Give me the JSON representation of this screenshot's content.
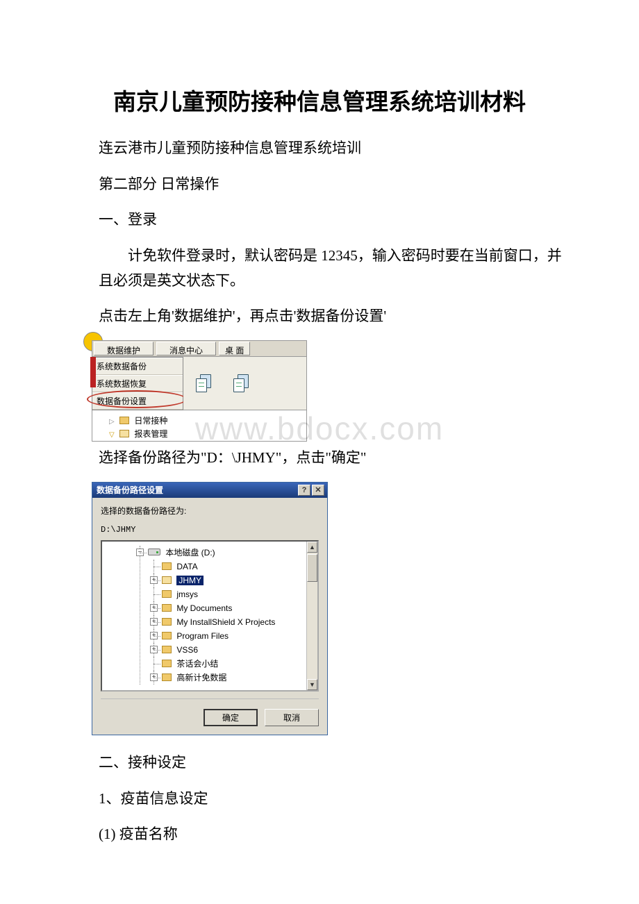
{
  "title": "南京儿童预防接种信息管理系统培训材料",
  "intro": {
    "line1": "连云港市儿童预防接种信息管理系统培训",
    "line2": "第二部分 日常操作",
    "sec1_title": "一、登录",
    "sec1_p1": "计免软件登录时，默认密码是 12345，输入密码时要在当前窗口，并且必须是英文状态下。",
    "sec1_p2": "点击左上角'数据维护'，再点击'数据备份设置'",
    "sec1_p3": "选择备份路径为\"D：\\JHMY\"，点击\"确定\"",
    "sec2_title": "二、接种设定",
    "sec2_item1": "1、疫苗信息设定",
    "sec2_item2": "(1)  疫苗名称"
  },
  "watermark": "www.bdocx.com",
  "shot1": {
    "btn_data_maint": "数据维护",
    "btn_msg_center": "消息中心",
    "btn_desktop": "桌 面",
    "menu": {
      "backup": "系统数据备份",
      "restore": "系统数据恢复",
      "path_setting": "数据备份设置"
    },
    "tree": {
      "daily": "日常接种",
      "baobiao": "报表管理"
    }
  },
  "dialog": {
    "title": "数据备份路径设置",
    "label": "选择的数据备份路径为:",
    "path": "D:\\JHMY",
    "drive": "本地磁盘 (D:)",
    "items": {
      "data": "DATA",
      "jhmy": "JHMY",
      "jmsys": "jmsys",
      "mydocs": "My Documents",
      "installshield": "My InstallShield X Projects",
      "progfiles": "Program Files",
      "vss6": "VSS6",
      "tea": "茶话会小结",
      "gaoxin": "高新计免数据"
    },
    "ok": "确定",
    "cancel": "取消"
  }
}
